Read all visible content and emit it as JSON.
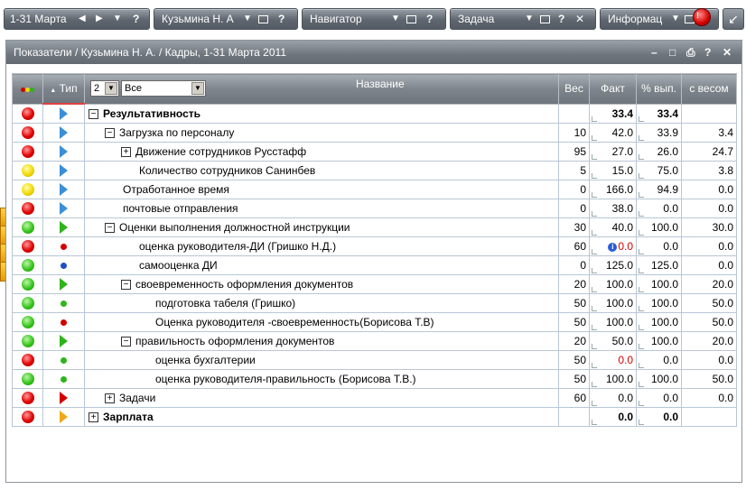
{
  "toolbar": {
    "period": "1-31 Марта",
    "user": "Кузьмина Н. А",
    "navigator": "Навигатор",
    "task": "Задача",
    "info": "Информац",
    "q": "?",
    "x": "✕",
    "prev": "◀",
    "next": "▶",
    "down": "▼",
    "collapse": "↙",
    "badge": "!"
  },
  "panel": {
    "title": "Показатели / Кузьмина Н. А. / Кадры, 1-31 Марта 2011",
    "minimize": "–",
    "restore": "□",
    "print": "⎙",
    "help": "?",
    "close": "✕"
  },
  "table": {
    "headers": {
      "type": "Тип",
      "type_arrow": "▲",
      "level": "2",
      "filter": "Все",
      "name": "Название",
      "weight": "Вес",
      "fact": "Факт",
      "pct": "% вып.",
      "weighted": "с весом"
    },
    "rows": [
      {
        "status": "red",
        "type": "tri-blue",
        "indent": 0,
        "box": "−",
        "name": "Результативность",
        "bold": true,
        "weight": "",
        "fact": "33.4",
        "fact_red": false,
        "info": false,
        "pct": "33.4",
        "weighted": ""
      },
      {
        "status": "red",
        "type": "tri-blue",
        "indent": 1,
        "box": "−",
        "name": "Загрузка по персоналу",
        "bold": false,
        "weight": "10",
        "fact": "42.0",
        "fact_red": false,
        "info": false,
        "pct": "33.9",
        "weighted": "3.4"
      },
      {
        "status": "red",
        "type": "tri-blue",
        "indent": 2,
        "box": "+",
        "name": "Движение сотрудников Русстафф",
        "bold": false,
        "weight": "95",
        "fact": "27.0",
        "fact_red": false,
        "info": false,
        "pct": "26.0",
        "weighted": "24.7"
      },
      {
        "status": "yellow",
        "type": "tri-blue",
        "indent": 2,
        "box": "",
        "name": "Количество сотрудников Санинбев",
        "bold": false,
        "weight": "5",
        "fact": "15.0",
        "fact_red": false,
        "info": false,
        "pct": "75.0",
        "weighted": "3.8"
      },
      {
        "status": "yellow",
        "type": "tri-blue",
        "indent": 1,
        "box": "",
        "name": "Отработанное время",
        "bold": false,
        "weight": "0",
        "fact": "166.0",
        "fact_red": false,
        "info": false,
        "pct": "94.9",
        "weighted": "0.0"
      },
      {
        "status": "red",
        "type": "tri-blue",
        "indent": 1,
        "box": "",
        "name": "почтовые отправления",
        "bold": false,
        "weight": "0",
        "fact": "38.0",
        "fact_red": false,
        "info": false,
        "pct": "0.0",
        "weighted": "0.0"
      },
      {
        "status": "green",
        "type": "tri-green",
        "indent": 1,
        "box": "−",
        "name": "Оценки выполнения должностной инструкции",
        "bold": false,
        "weight": "30",
        "fact": "40.0",
        "fact_red": false,
        "info": false,
        "pct": "100.0",
        "weighted": "30.0"
      },
      {
        "status": "red",
        "type": "dot-red",
        "indent": 2,
        "box": "",
        "name": "оценка руководителя-ДИ (Гришко Н.Д.)",
        "bold": false,
        "weight": "60",
        "fact": "0.0",
        "fact_red": true,
        "info": true,
        "pct": "0.0",
        "weighted": "0.0"
      },
      {
        "status": "green",
        "type": "dot-blue",
        "indent": 2,
        "box": "",
        "name": "самооценка ДИ",
        "bold": false,
        "weight": "0",
        "fact": "125.0",
        "fact_red": false,
        "info": false,
        "pct": "125.0",
        "weighted": "0.0"
      },
      {
        "status": "green",
        "type": "tri-green",
        "indent": 2,
        "box": "−",
        "name": "своевременность оформления документов",
        "bold": false,
        "weight": "20",
        "fact": "100.0",
        "fact_red": false,
        "info": false,
        "pct": "100.0",
        "weighted": "20.0"
      },
      {
        "status": "green",
        "type": "dot-green",
        "indent": 3,
        "box": "",
        "name": "подготовка табеля (Гришко)",
        "bold": false,
        "weight": "50",
        "fact": "100.0",
        "fact_red": false,
        "info": false,
        "pct": "100.0",
        "weighted": "50.0"
      },
      {
        "status": "green",
        "type": "dot-red",
        "indent": 3,
        "box": "",
        "name": "Оценка руководителя -своевременность(Борисова Т.В)",
        "bold": false,
        "weight": "50",
        "fact": "100.0",
        "fact_red": false,
        "info": false,
        "pct": "100.0",
        "weighted": "50.0"
      },
      {
        "status": "green",
        "type": "tri-green",
        "indent": 2,
        "box": "−",
        "name": "правильность оформления документов",
        "bold": false,
        "weight": "20",
        "fact": "50.0",
        "fact_red": false,
        "info": false,
        "pct": "100.0",
        "weighted": "20.0"
      },
      {
        "status": "red",
        "type": "dot-green",
        "indent": 3,
        "box": "",
        "name": "оценка бухгалтерии",
        "bold": false,
        "weight": "50",
        "fact": "0.0",
        "fact_red": true,
        "info": false,
        "pct": "0.0",
        "weighted": "0.0"
      },
      {
        "status": "green",
        "type": "dot-green",
        "indent": 3,
        "box": "",
        "name": "оценка руководителя-правильность (Борисова Т.В.)",
        "bold": false,
        "weight": "50",
        "fact": "100.0",
        "fact_red": false,
        "info": false,
        "pct": "100.0",
        "weighted": "50.0"
      },
      {
        "status": "red",
        "type": "tri-red",
        "indent": 1,
        "box": "+",
        "name": "Задачи",
        "bold": false,
        "weight": "60",
        "fact": "0.0",
        "fact_red": false,
        "info": false,
        "pct": "0.0",
        "weighted": "0.0"
      },
      {
        "status": "red",
        "type": "tri-orange",
        "indent": 0,
        "box": "+",
        "name": "Зарплата",
        "bold": true,
        "weight": "",
        "fact": "0.0",
        "fact_red": false,
        "info": false,
        "pct": "0.0",
        "weighted": ""
      }
    ]
  },
  "side_tools": [
    {
      "name": "tip-lamp-icon",
      "glyph": "💡"
    },
    {
      "name": "bug-icon",
      "glyph": "✱"
    },
    {
      "name": "help-icon",
      "glyph": "?"
    },
    {
      "name": "thumb-icon",
      "glyph": "✋"
    }
  ]
}
